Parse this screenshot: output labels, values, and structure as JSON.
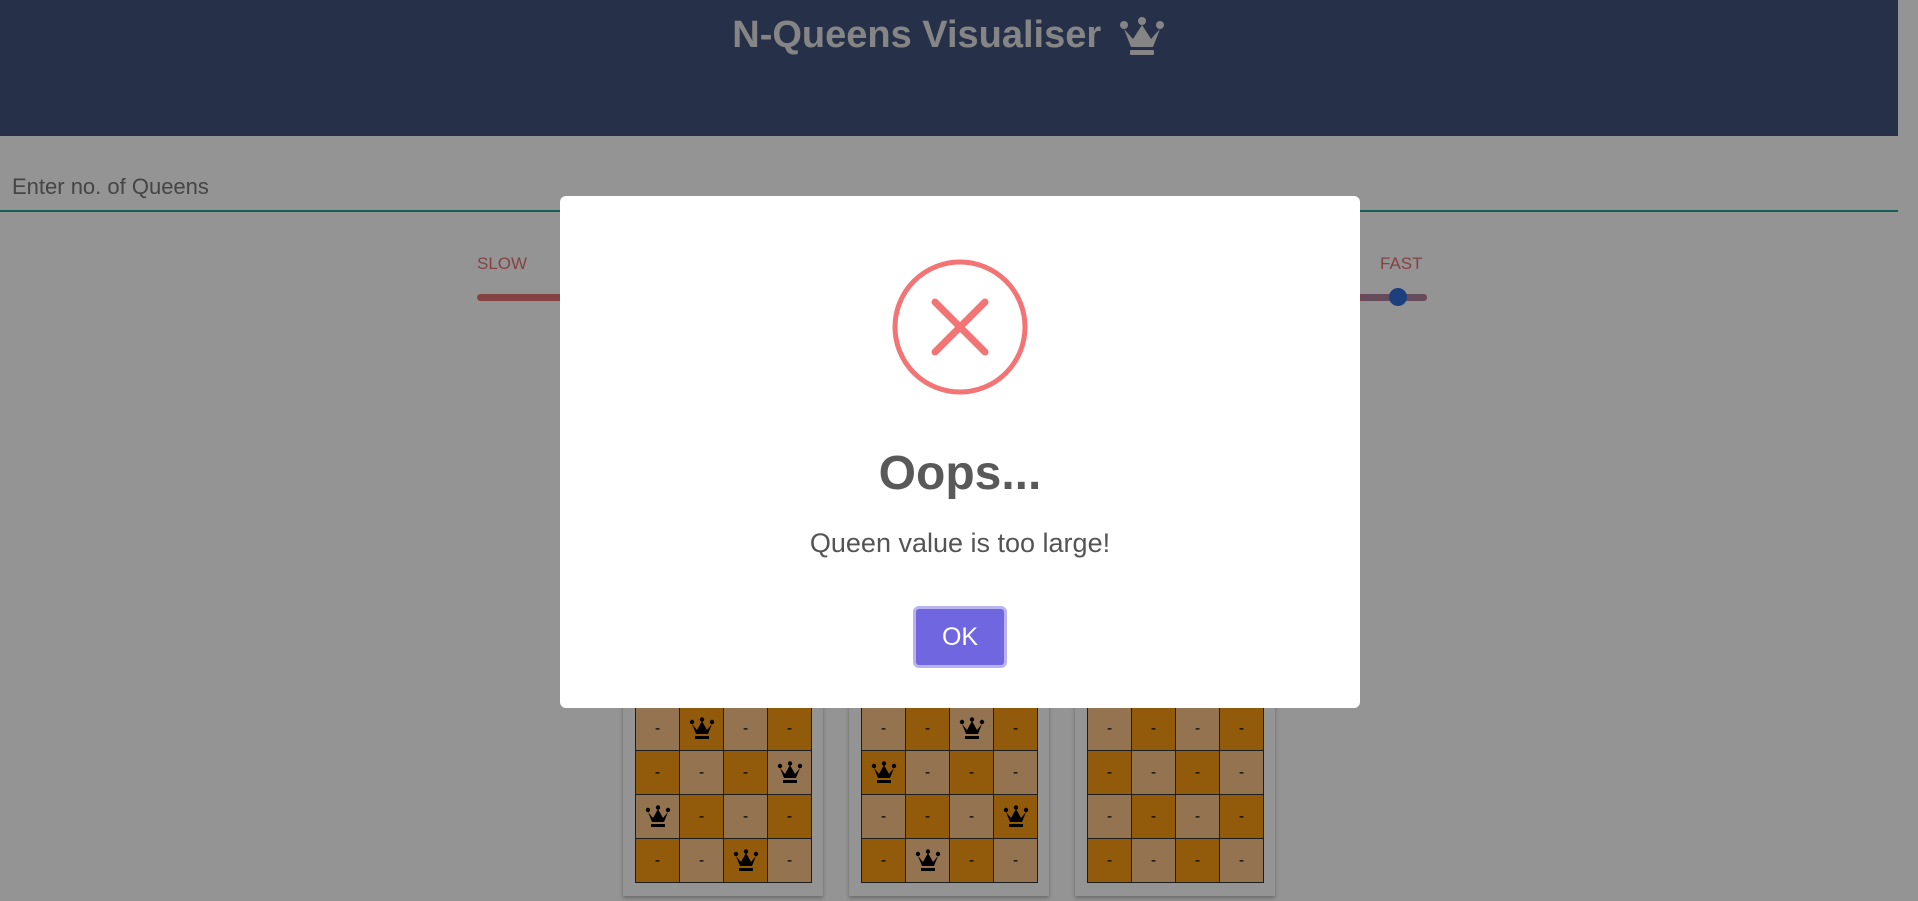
{
  "header": {
    "title": "N-Queens Visualiser"
  },
  "queen_input": {
    "placeholder": "Enter no. of Queens",
    "value": ""
  },
  "speed": {
    "slow_label": "SLOW",
    "fast_label": "FAST",
    "level_fraction": 0.96
  },
  "boards": [
    {
      "rows": [
        [
          "-",
          "Q",
          "-",
          "-"
        ],
        [
          "-",
          "-",
          "-",
          "Q"
        ],
        [
          "Q",
          "-",
          "-",
          "-"
        ],
        [
          "-",
          "-",
          "Q",
          "-"
        ]
      ]
    },
    {
      "rows": [
        [
          "-",
          "-",
          "Q",
          "-"
        ],
        [
          "Q",
          "-",
          "-",
          "-"
        ],
        [
          "-",
          "-",
          "-",
          "Q"
        ],
        [
          "-",
          "Q",
          "-",
          "-"
        ]
      ]
    },
    {
      "rows": [
        [
          "-",
          "-",
          "-",
          "-"
        ],
        [
          "-",
          "-",
          "-",
          "-"
        ],
        [
          "-",
          "-",
          "-",
          "-"
        ],
        [
          "-",
          "-",
          "-",
          "-"
        ]
      ]
    }
  ],
  "modal": {
    "icon": "error-x-icon",
    "title": "Oops...",
    "text": "Queen value is too large!",
    "ok_label": "OK"
  },
  "colors": {
    "header_bg": "#42557e",
    "board_light": "#ffc88a",
    "board_dark": "#fb9e13",
    "error_red": "#f27474",
    "ok_button": "#7066e0"
  }
}
